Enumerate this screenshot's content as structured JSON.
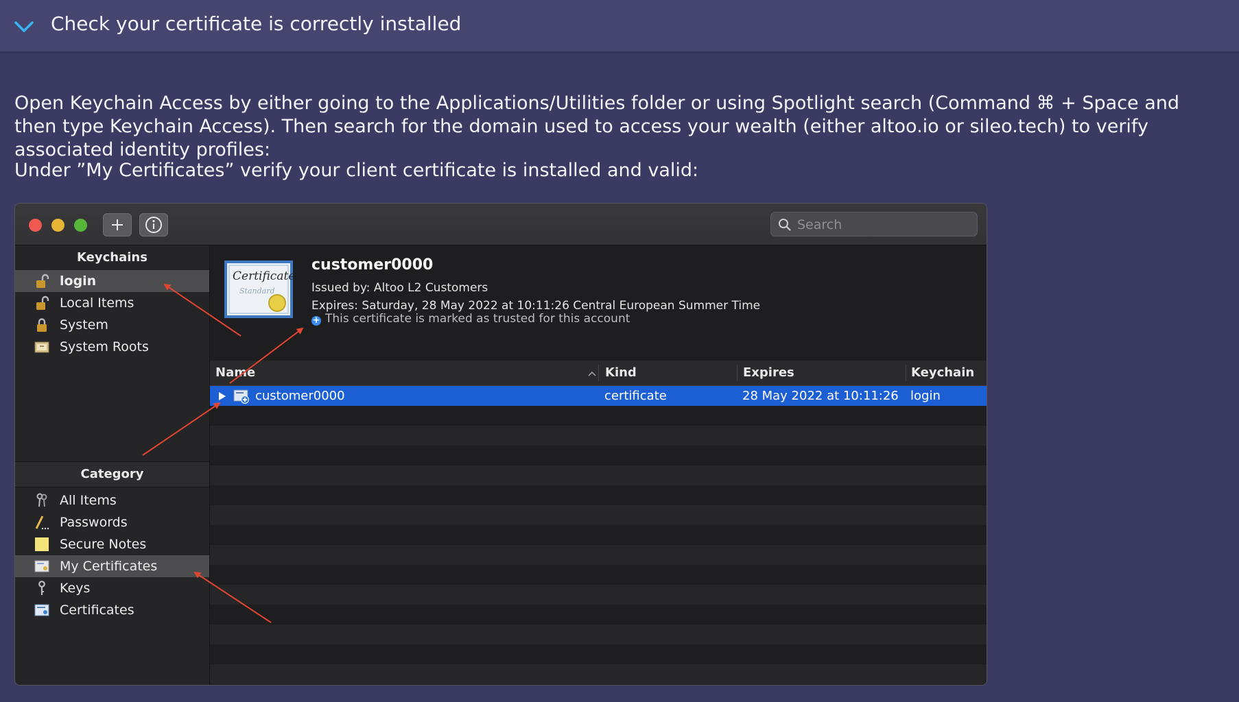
{
  "accordion": {
    "title": "Check your certificate is correctly installed"
  },
  "instructions": {
    "paragraph1": "Open Keychain Access by either going to the Applications/Utilities folder or using Spotlight search (Command ⌘ + Space and then type Keychain Access). Then search for the domain used to access your wealth (either altoo.io or sileo.tech) to verify associated identity profiles:",
    "paragraph2": "Under ”My Certificates” verify your client certificate is installed and valid:"
  },
  "window": {
    "toolbar": {
      "add_icon": "plus-icon",
      "info_icon": "info-icon",
      "search_placeholder": "Search"
    },
    "traffic_lights": {
      "close": "#ee5a52",
      "minimize": "#e6b634",
      "zoom": "#58b63b"
    },
    "sidebar": {
      "keychains_title": "Keychains",
      "keychains": [
        {
          "label": "login",
          "icon": "unlocked-padlock-icon",
          "selected": true
        },
        {
          "label": "Local Items",
          "icon": "unlocked-padlock-icon",
          "selected": false
        },
        {
          "label": "System",
          "icon": "locked-padlock-icon",
          "selected": false
        },
        {
          "label": "System Roots",
          "icon": "cabinet-icon",
          "selected": false
        }
      ],
      "category_title": "Category",
      "categories": [
        {
          "label": "All Items",
          "icon": "keys-icon",
          "selected": false
        },
        {
          "label": "Passwords",
          "icon": "pencil-icon",
          "selected": false
        },
        {
          "label": "Secure Notes",
          "icon": "note-icon",
          "selected": false
        },
        {
          "label": "My Certificates",
          "icon": "my-certificate-icon",
          "selected": true
        },
        {
          "label": "Keys",
          "icon": "key-icon",
          "selected": false
        },
        {
          "label": "Certificates",
          "icon": "certificate-icon",
          "selected": false
        }
      ]
    },
    "detail": {
      "name": "customer0000",
      "issued_by": "Issued by: Altoo L2 Customers",
      "expires": "Expires: Saturday, 28 May 2022 at 10:11:26 Central European Summer Time",
      "trusted": "This certificate is marked as trusted for this account",
      "trusted_icon": "plus-badge-icon",
      "cert_image_text": "Certificate",
      "cert_image_subtext": "Standard"
    },
    "table": {
      "columns": [
        "Name",
        "Kind",
        "Expires",
        "Keychain"
      ],
      "rows": [
        {
          "name": "customer0000",
          "kind": "certificate",
          "expires": "28 May 2022 at 10:11:26",
          "keychain": "login",
          "selected": true
        }
      ]
    },
    "accent": "#1c5fd4",
    "annotation_color": "#e0452f"
  }
}
